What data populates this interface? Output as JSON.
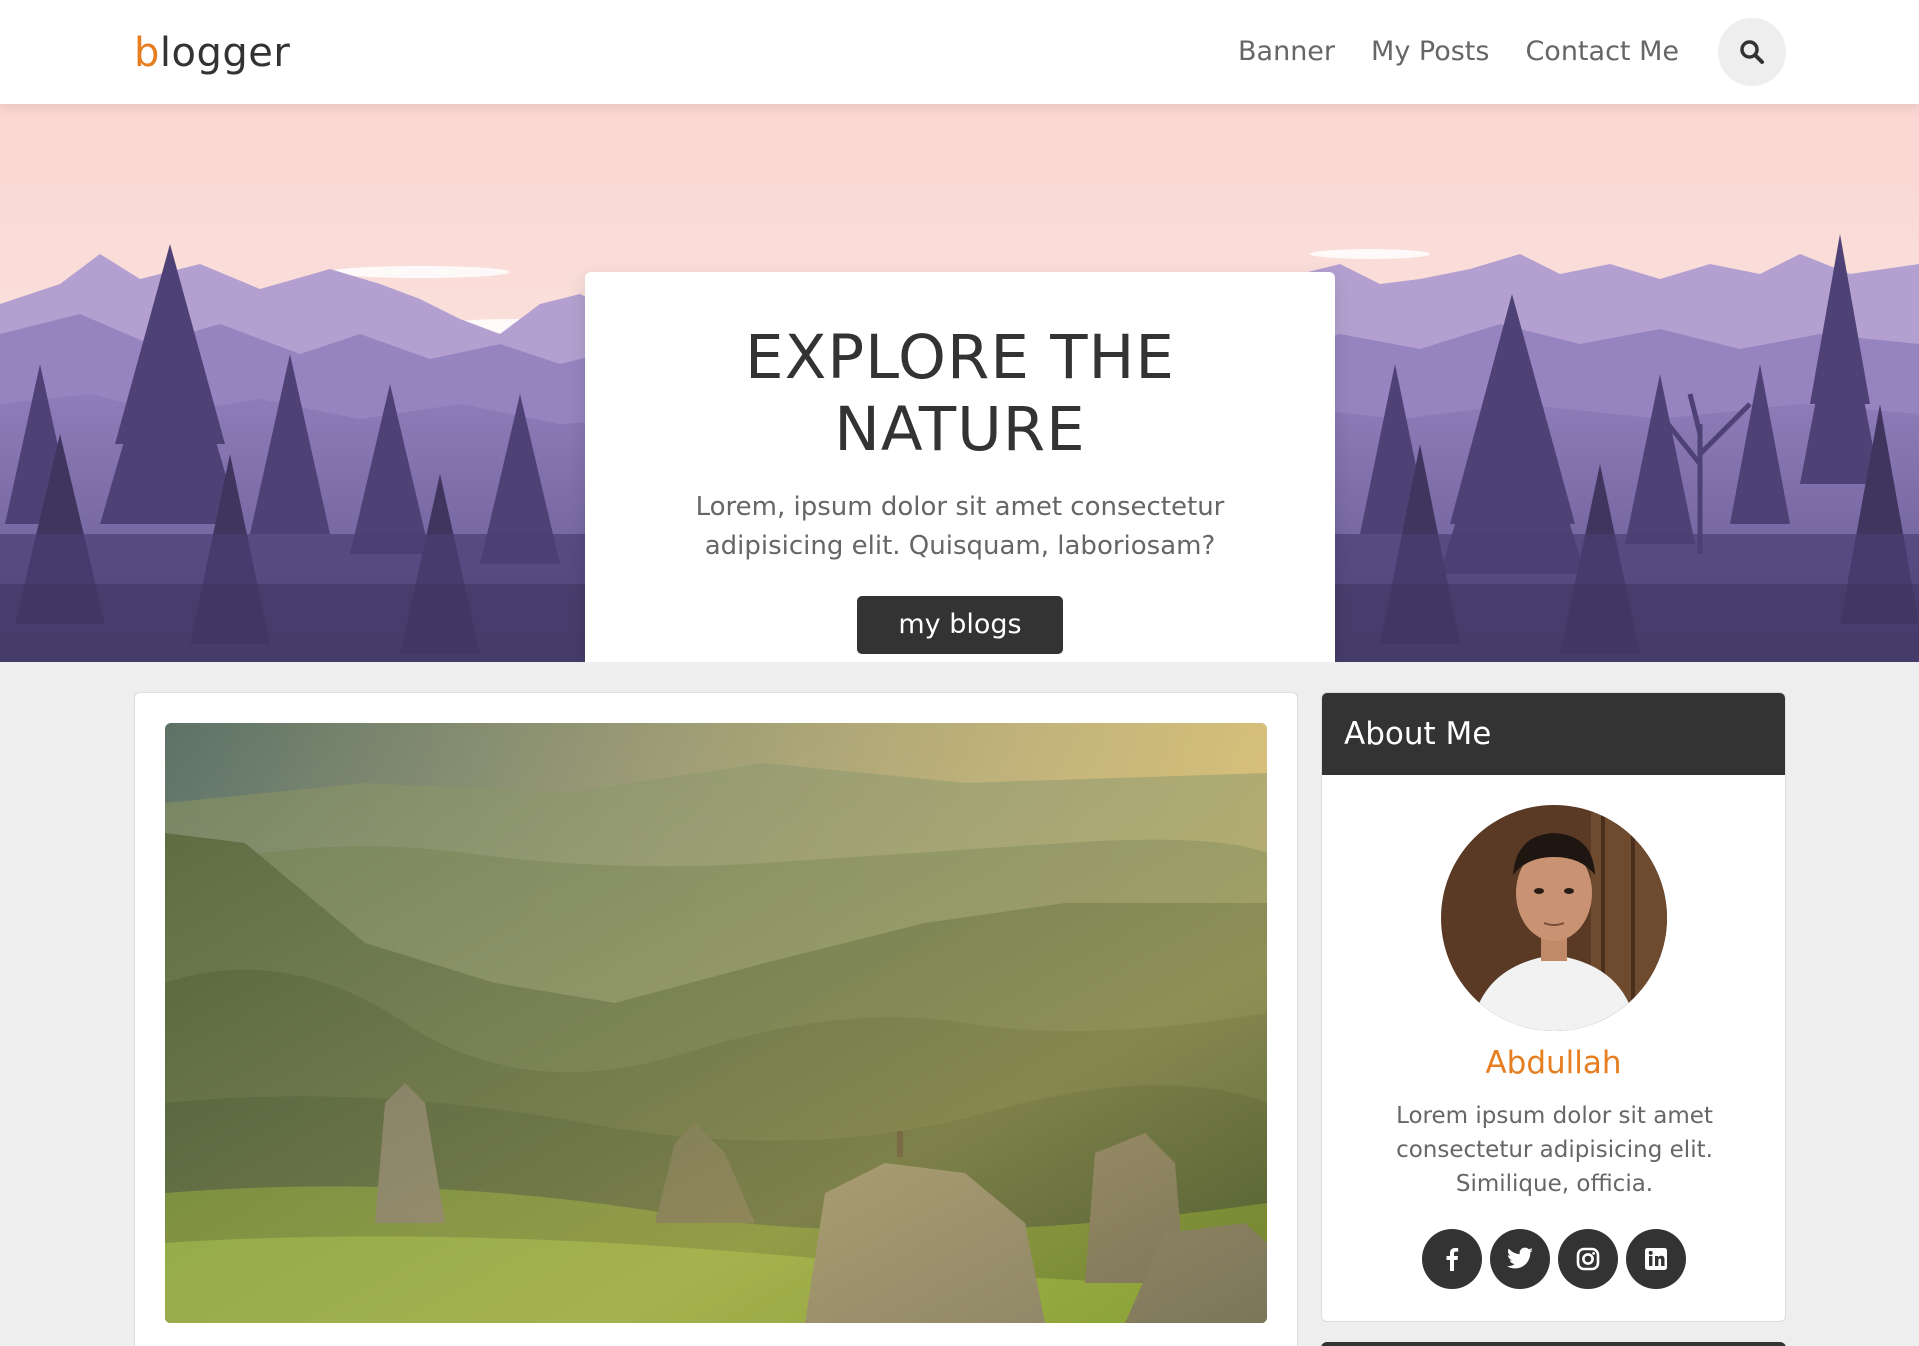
{
  "header": {
    "logo_accent": "b",
    "logo_rest": "logger",
    "nav": [
      {
        "label": "Banner"
      },
      {
        "label": "My Posts"
      },
      {
        "label": "Contact Me"
      }
    ],
    "search_icon": "search-icon"
  },
  "banner": {
    "title_line1": "EXPLORE THE",
    "title_line2": "NATURE",
    "description": "Lorem, ipsum dolor sit amet consectetur adipisicing elit. Quisquam, laboriosam?",
    "button_label": "my blogs"
  },
  "post": {
    "image": "mountain-landscape-photo"
  },
  "about": {
    "heading": "About Me",
    "name": "Abdullah",
    "bio": "Lorem ipsum dolor sit amet consectetur adipisicing elit. Similique, officia.",
    "socials": [
      {
        "icon": "facebook-icon"
      },
      {
        "icon": "twitter-icon"
      },
      {
        "icon": "instagram-icon"
      },
      {
        "icon": "linkedin-icon"
      }
    ]
  },
  "colors": {
    "accent": "#e67e22",
    "dark": "#333333",
    "page_bg": "#eeeeee"
  }
}
